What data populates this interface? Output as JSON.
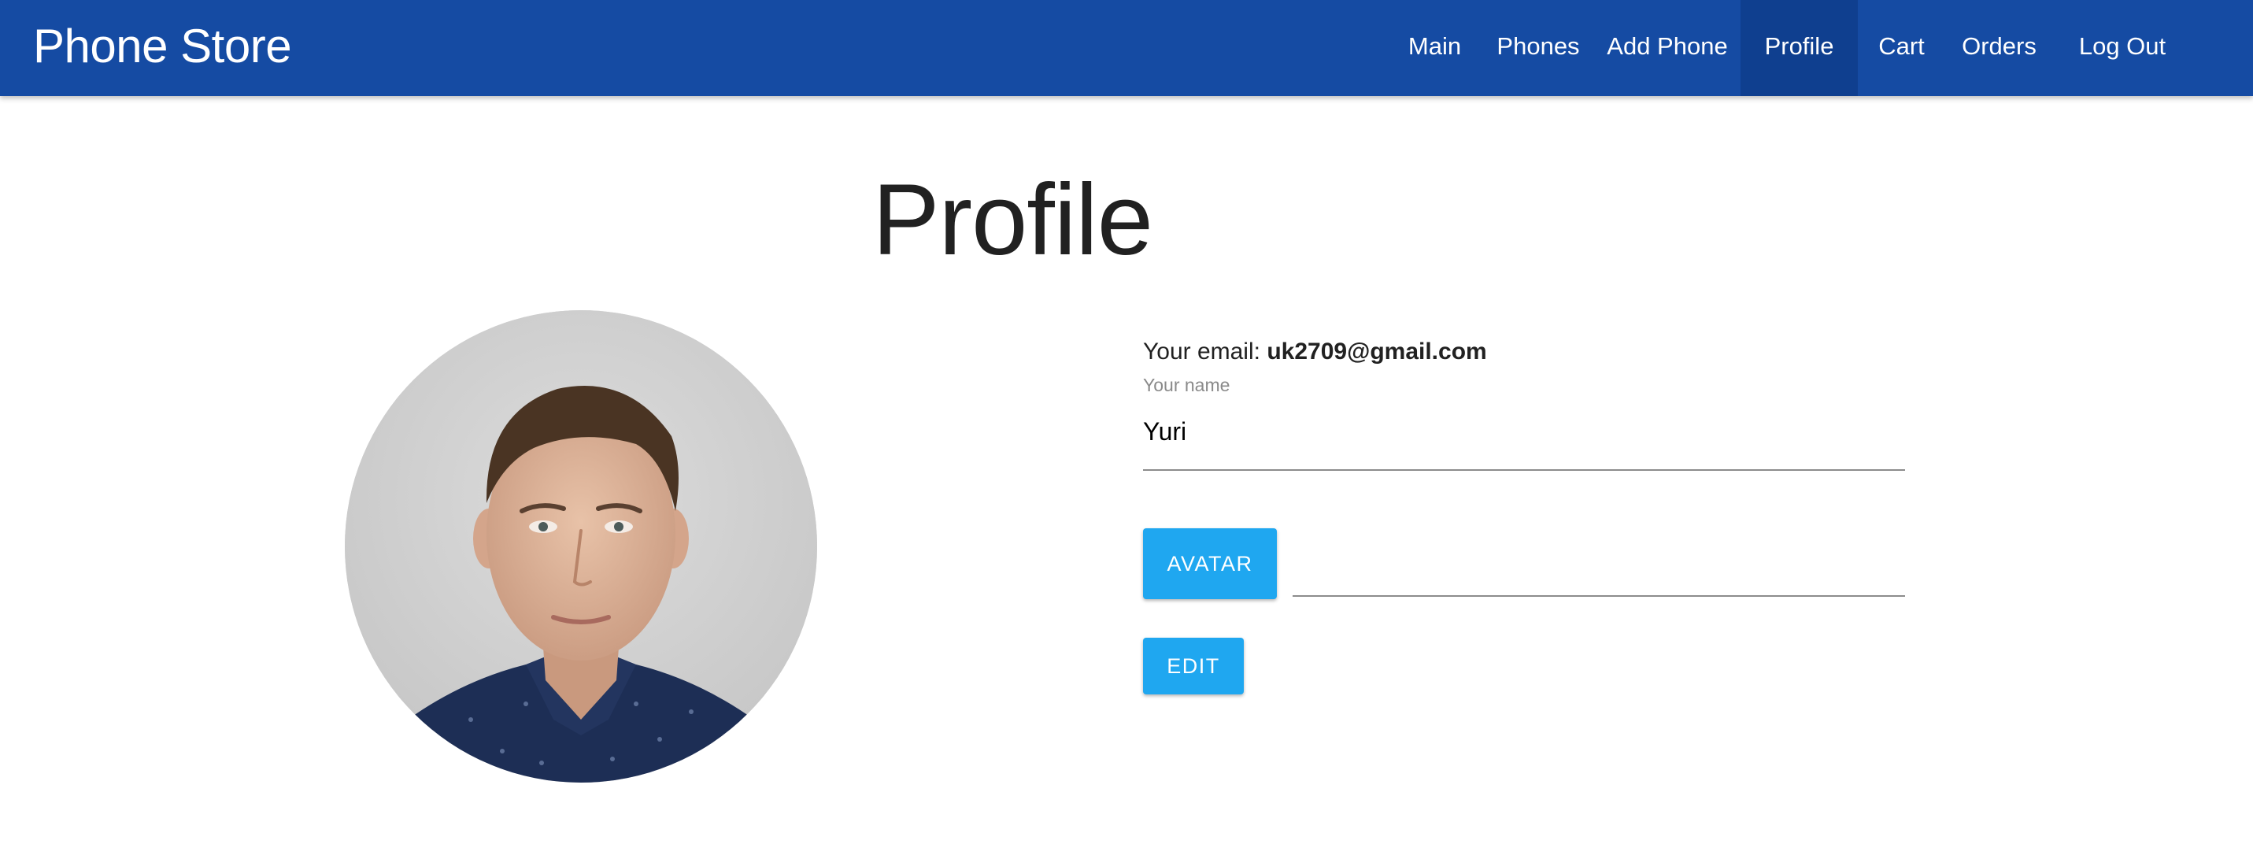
{
  "app": {
    "brand": "Phone Store"
  },
  "nav": {
    "items": [
      {
        "label": "Main"
      },
      {
        "label": "Phones"
      },
      {
        "label": "Add Phone"
      },
      {
        "label": "Profile",
        "active": true
      },
      {
        "label": "Cart"
      },
      {
        "label": "Orders"
      },
      {
        "label": "Log Out"
      }
    ]
  },
  "page": {
    "title": "Profile"
  },
  "profile": {
    "email_prefix": "Your email:",
    "email": "uk2709@gmail.com",
    "name_label": "Your name",
    "name_value": "Yuri",
    "avatar_button": "Avatar",
    "edit_button": "Edit"
  },
  "colors": {
    "navbar": "#154ba3",
    "navbar_active": "#0f3f8f",
    "button": "#1fa7f0"
  }
}
